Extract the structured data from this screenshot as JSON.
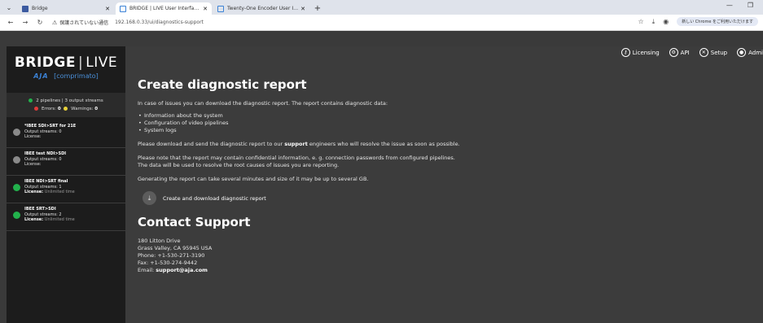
{
  "browser": {
    "tabs": [
      {
        "title": "Bridge",
        "favicon_color": "#3b5aa0",
        "active": false
      },
      {
        "title": "BRIDGE | LIVE User Interface - C",
        "favicon_color": "#3b82d6",
        "active": true
      },
      {
        "title": "Twenty-One Encoder User Interf",
        "favicon_color": "#3b82d6",
        "active": false
      }
    ],
    "security_text": "保護されていない通信",
    "url": "192.168.0.33/ui/diagnostics-support",
    "chrome_promo": "新しい Chrome をご利用いただけます"
  },
  "sidebar": {
    "logo_bridge": "BRIDGE",
    "logo_sep": "|",
    "logo_live": "LIVE",
    "logo_aja": "AJA",
    "logo_comp": "[comprimato]",
    "status_summary": "2 pipelines | 3 output streams",
    "errors_label": "Errors:",
    "errors_value": "0",
    "warnings_label": "Warnings:",
    "warnings_value": "0",
    "pipelines": [
      {
        "name": "*IBEE SDI>SRT for 21E",
        "streams": "Output streams: 0",
        "license_label": "License:",
        "license_value": "",
        "state_color": "#8a8a8a"
      },
      {
        "name": "IBEE test NDI>SDI",
        "streams": "Output streams: 0",
        "license_label": "License:",
        "license_value": "",
        "state_color": "#8a8a8a"
      },
      {
        "name": "IBEE NDI>SRT final",
        "streams": "Output streams: 1",
        "license_label": "License:",
        "license_value": "Unlimited time",
        "state_color": "#22b14c"
      },
      {
        "name": "IBEE SRT>SDI",
        "streams": "Output streams: 2",
        "license_label": "License:",
        "license_value": "Unlimited time",
        "state_color": "#22b14c"
      }
    ]
  },
  "topnav": {
    "licensing": "Licensing",
    "api": "API",
    "setup": "Setup",
    "admin": "Admi"
  },
  "main": {
    "title": "Create diagnostic report",
    "intro": "In case of issues you can download the diagnostic report. The report contains diagnostic data:",
    "items": [
      "Information about the system",
      "Configuration of video pipelines",
      "System logs"
    ],
    "send_pre": "Please download and send the diagnostic report to our ",
    "send_bold": "support",
    "send_post": " engineers who will resolve the issue as soon as possible.",
    "note1": "Please note that the report may contain confidential information, e. g. connection passwords from configured pipelines.",
    "note2": "The data will be used to resolve the root causes of issues you are reporting.",
    "gen_note": "Generating the report can take several minutes and size of it may be up to several GB.",
    "download_label": "Create and download diagnostic report",
    "contact_title": "Contact Support",
    "address1": "180 Litton Drive",
    "address2": "Grass Valley, CA 95945 USA",
    "phone": "Phone: +1-530-271-3190",
    "fax": "Fax: +1-530-274-9442",
    "email_label": "Email: ",
    "email": "support@aja.com"
  },
  "colors": {
    "error_dot": "#e03a3a",
    "warning_dot": "#e8d23a",
    "pipelines_dot": "#22b14c"
  }
}
